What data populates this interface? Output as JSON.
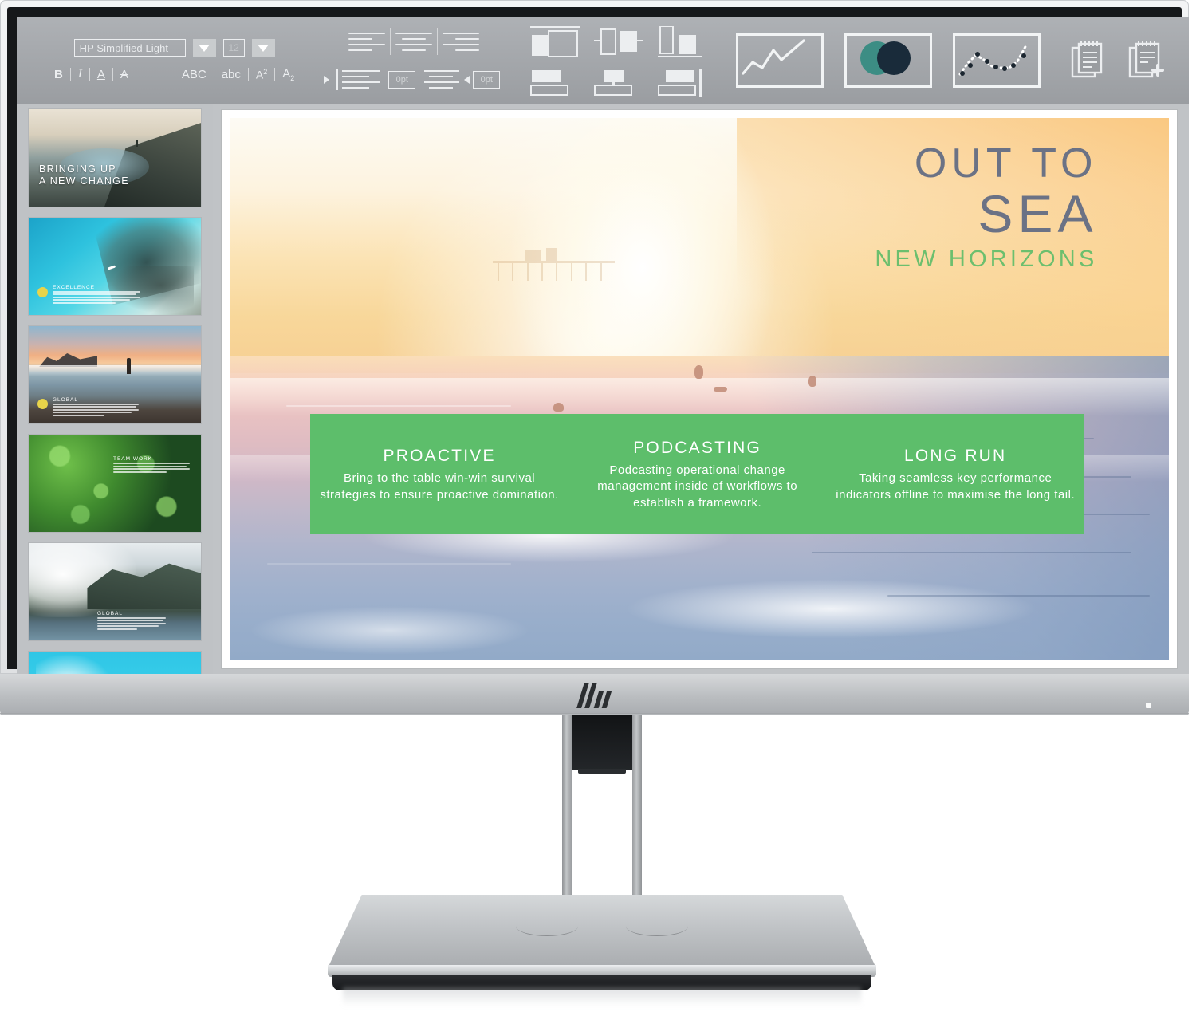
{
  "device": {
    "brand": "HP",
    "logo_name": "hp-logo",
    "power_led": "power-led-indicator"
  },
  "toolbar": {
    "font": {
      "family_value": "HP Simplified Light",
      "family_placeholder": "HP Simplified Light",
      "family_dropdown": "font-family-dropdown",
      "size_value": "12",
      "size_dropdown": "font-size-dropdown"
    },
    "text_styles": [
      {
        "label": "B",
        "name": "bold-button"
      },
      {
        "label": "I",
        "name": "italic-button"
      },
      {
        "label": "A",
        "name": "underline-button"
      },
      {
        "label": "A",
        "name": "strikethrough-button"
      }
    ],
    "case_styles": [
      {
        "label": "ABC",
        "name": "uppercase-button"
      },
      {
        "label": "abc",
        "name": "lowercase-button"
      },
      {
        "label": "A",
        "sup": "2",
        "name": "superscript-button"
      },
      {
        "label": "A",
        "sub": "2",
        "name": "subscript-button"
      }
    ],
    "align": [
      {
        "name": "align-left-button"
      },
      {
        "name": "align-center-button"
      },
      {
        "name": "align-right-button"
      }
    ],
    "indent": [
      {
        "label": "0pt",
        "name": "increase-indent-button"
      },
      {
        "label": "0pt",
        "name": "decrease-indent-button"
      }
    ],
    "layout": [
      {
        "name": "layout-two-column-button"
      },
      {
        "name": "layout-split-button"
      },
      {
        "name": "layout-chart-button"
      },
      {
        "name": "layout-image-top-button"
      },
      {
        "name": "layout-image-center-button"
      },
      {
        "name": "layout-image-right-button"
      }
    ],
    "charts": [
      {
        "name": "line-chart-button"
      },
      {
        "name": "venn-diagram-button"
      },
      {
        "name": "scatter-chart-button"
      }
    ],
    "documents": [
      {
        "name": "notes-button"
      },
      {
        "name": "add-note-button"
      },
      {
        "name": "document-button"
      },
      {
        "name": "duplicate-page-button"
      }
    ],
    "insert_image": {
      "name": "insert-image-button",
      "active": true
    },
    "accent_teal": "#3c8d84",
    "accent_navy": "#192b3a"
  },
  "sidebar": {
    "slides": [
      {
        "index": 1,
        "title": "BRINGING UP\nA NEW CHANGE",
        "line1": "BRINGING UP",
        "line2": "A NEW CHANGE",
        "name": "slide-thumbnail-1"
      },
      {
        "index": 2,
        "title": "EXCELLENCE",
        "name": "slide-thumbnail-2"
      },
      {
        "index": 3,
        "title": "GLOBAL",
        "name": "slide-thumbnail-3"
      },
      {
        "index": 4,
        "title": "TEAM WORK",
        "name": "slide-thumbnail-4"
      },
      {
        "index": 5,
        "title": "GLOBAL",
        "name": "slide-thumbnail-5"
      },
      {
        "index": 6,
        "title": "",
        "name": "slide-thumbnail-6"
      }
    ],
    "body_placeholder": "Drawn from previous projects suggest that a global approach provides a broader scope of information for a well rounded presentation."
  },
  "slide": {
    "title_line1": "OUT TO",
    "title_line2": "SEA",
    "subtitle": "NEW HORIZONS",
    "title_color": "#6b7285",
    "subtitle_color": "#6cbf6e",
    "panel_color": "#5dbe6b",
    "columns": [
      {
        "heading": "PROACTIVE",
        "body": "Bring to the table win-win survival strategies to ensure proactive domination.",
        "name": "slide-column-proactive"
      },
      {
        "heading": "PODCASTING",
        "body": "Podcasting operational change management inside of workflows to establish a framework.",
        "name": "slide-column-podcasting"
      },
      {
        "heading": "LONG RUN",
        "body": "Taking seamless key performance indicators offline to maximise the long tail.",
        "name": "slide-column-long-run"
      }
    ]
  }
}
